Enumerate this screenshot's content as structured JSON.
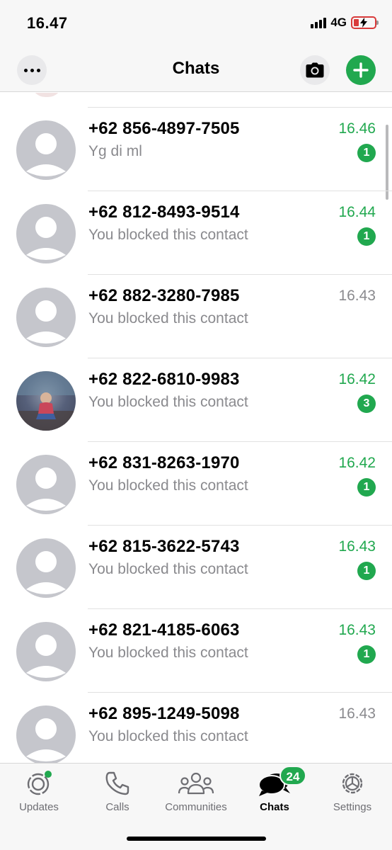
{
  "status_bar": {
    "time": "16.47",
    "network": "4G"
  },
  "header": {
    "title": "Chats",
    "more_icon": "more-horizontal-icon",
    "camera_icon": "camera-icon",
    "add_icon": "plus-icon"
  },
  "colors": {
    "accent": "#21a84f",
    "secondary_text": "#8a8a8e",
    "avatar_placeholder": "#c5c6cc",
    "battery_low": "#d93a3a"
  },
  "chats": [
    {
      "name": "+62 856-4897-7505",
      "preview": "Yg di ml",
      "time": "16.46",
      "unread": "1"
    },
    {
      "name": "+62 812-8493-9514",
      "preview": "You blocked this contact",
      "time": "16.44",
      "unread": "1"
    },
    {
      "name": "+62 882-3280-7985",
      "preview": "You blocked this contact",
      "time": "16.43",
      "unread": ""
    },
    {
      "name": "+62 822-6810-9983",
      "preview": "You blocked this contact",
      "time": "16.42",
      "unread": "3"
    },
    {
      "name": "+62 831-8263-1970",
      "preview": "You blocked this contact",
      "time": "16.42",
      "unread": "1"
    },
    {
      "name": "+62 815-3622-5743",
      "preview": "You blocked this contact",
      "time": "16.43",
      "unread": "1"
    },
    {
      "name": "+62 821-4185-6063",
      "preview": "You blocked this contact",
      "time": "16.43",
      "unread": "1"
    },
    {
      "name": "+62 895-1249-5098",
      "preview": "You blocked this contact",
      "time": "16.43",
      "unread": ""
    }
  ],
  "tabs": [
    {
      "label": "Updates",
      "icon": "updates-icon"
    },
    {
      "label": "Calls",
      "icon": "phone-icon"
    },
    {
      "label": "Communities",
      "icon": "communities-icon"
    },
    {
      "label": "Chats",
      "icon": "chats-icon",
      "badge": "24"
    },
    {
      "label": "Settings",
      "icon": "settings-icon"
    }
  ]
}
